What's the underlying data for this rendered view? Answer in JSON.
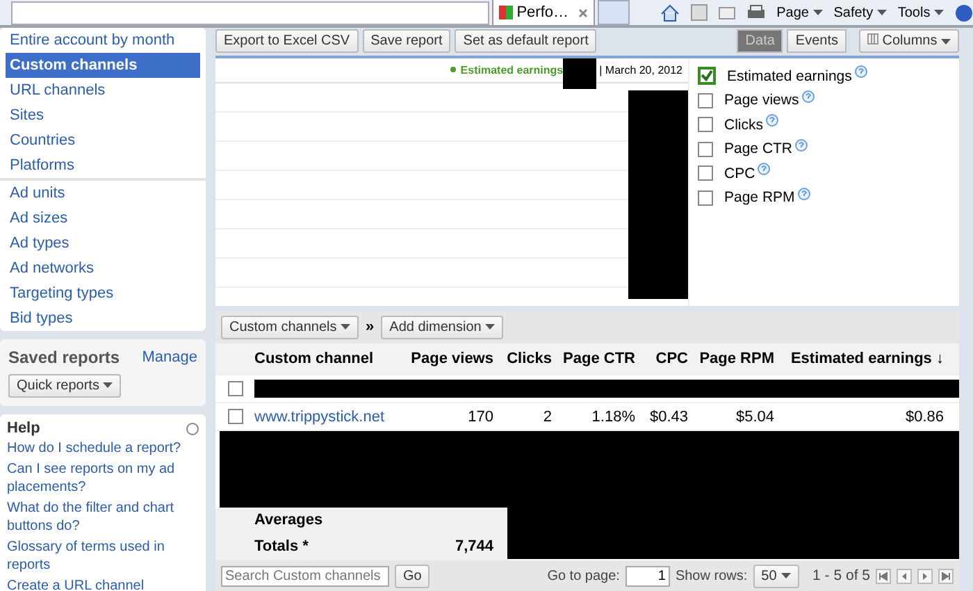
{
  "browser": {
    "tab_title": "Perfo…",
    "menus": [
      "Page",
      "Safety",
      "Tools"
    ]
  },
  "sidebar": {
    "groups": [
      {
        "items": [
          {
            "label": "Entire account by month",
            "selected": false
          },
          {
            "label": "Custom channels",
            "selected": true
          },
          {
            "label": "URL channels",
            "selected": false
          },
          {
            "label": "Sites",
            "selected": false
          },
          {
            "label": "Countries",
            "selected": false
          },
          {
            "label": "Platforms",
            "selected": false
          }
        ]
      },
      {
        "items": [
          {
            "label": "Ad units",
            "selected": false
          },
          {
            "label": "Ad sizes",
            "selected": false
          },
          {
            "label": "Ad types",
            "selected": false
          },
          {
            "label": "Ad networks",
            "selected": false
          },
          {
            "label": "Targeting types",
            "selected": false
          },
          {
            "label": "Bid types",
            "selected": false
          }
        ]
      }
    ],
    "saved_reports": {
      "title": "Saved reports",
      "manage": "Manage",
      "dropdown": "Quick reports"
    },
    "help": {
      "title": "Help",
      "links": [
        "How do I schedule a report?",
        "Can I see reports on my ad placements?",
        "What do the filter and chart buttons do?",
        "Glossary of terms used in reports",
        "Create a URL channel"
      ]
    }
  },
  "toolbar": {
    "buttons": [
      "Export to Excel CSV",
      "Save report",
      "Set as default report"
    ],
    "views": [
      {
        "label": "Data",
        "selected": true
      },
      {
        "label": "Events",
        "selected": false
      }
    ],
    "columns": "Columns"
  },
  "chart": {
    "legend": "Estimated earnings",
    "date": "| March 20, 2012",
    "metrics": [
      {
        "label": "Estimated earnings",
        "checked": true
      },
      {
        "label": "Page views",
        "checked": false
      },
      {
        "label": "Clicks",
        "checked": false
      },
      {
        "label": "Page CTR",
        "checked": false
      },
      {
        "label": "CPC",
        "checked": false
      },
      {
        "label": "Page RPM",
        "checked": false
      }
    ]
  },
  "table": {
    "dimension": "Custom channels",
    "separator": "»",
    "add_dimension": "Add dimension",
    "columns": [
      "Custom channel",
      "Page views",
      "Clicks",
      "Page CTR",
      "CPC",
      "Page RPM",
      "Estimated earnings ↓"
    ],
    "rows": [
      {
        "kind": "redacted",
        "checked": false
      },
      {
        "kind": "data",
        "checked": false,
        "cells": [
          "www.trippystick.net",
          "170",
          "2",
          "1.18%",
          "$0.43",
          "$5.04",
          "$0.86"
        ]
      }
    ],
    "averages": "Averages",
    "totals": "Totals *",
    "totals_value": "7,744"
  },
  "footer": {
    "search_placeholder": "Search Custom channels",
    "go": "Go",
    "page_label": "Go to page:",
    "page_value": "1",
    "rows_label": "Show rows:",
    "rows_value": "50",
    "range": "1 - 5 of 5"
  }
}
